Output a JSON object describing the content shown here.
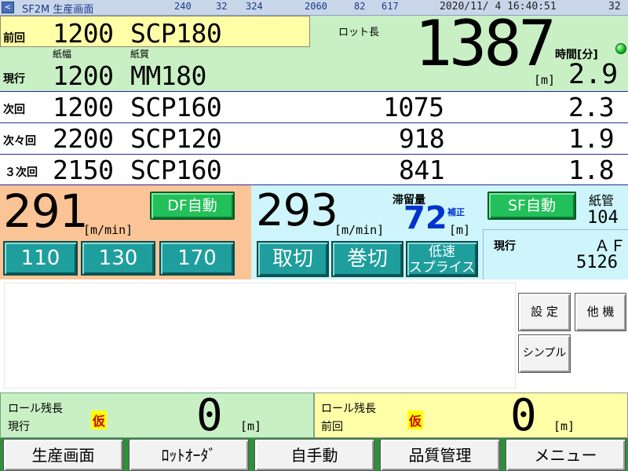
{
  "titlebar": {
    "title": "SF2M 生産画面",
    "nums": [
      "240",
      "32",
      "324",
      "2060",
      "82",
      "617"
    ],
    "datetime": "2020/11/ 4 16:40:51",
    "right_num": "32"
  },
  "current_lot": {
    "prev_label": "前回",
    "prev_width": "1200",
    "prev_grade": "SCP180",
    "width_label": "紙幅",
    "grade_label": "紙質",
    "cur_label": "現行",
    "cur_width": "1200",
    "cur_grade": "MM180",
    "lot_length_label": "ロット長",
    "lot_length": "1387",
    "lot_unit": "[m]",
    "time_label": "時間[分]",
    "time_value": "2.9"
  },
  "next_rows": [
    {
      "label": "次回",
      "width": "1200",
      "grade": "SCP160",
      "length": "1075",
      "time": "2.3"
    },
    {
      "label": "次々回",
      "width": "2200",
      "grade": "SCP120",
      "length": "918",
      "time": "1.9"
    },
    {
      "label": "３次回",
      "width": "2150",
      "grade": "SCP160",
      "length": "841",
      "time": "1.8"
    }
  ],
  "df": {
    "speed": "291",
    "unit": "[m/min]",
    "auto_button": "DF自動",
    "presets": [
      "110",
      "130",
      "170"
    ]
  },
  "sf_speed": {
    "speed": "293",
    "unit": "[m/min]",
    "retention_label": "滞留量",
    "retention_value": "72",
    "correction_label": "補正",
    "retention_unit": "[m]",
    "cut_button": "取切",
    "wind_cut_button": "巻切",
    "splice_button_1": "低速",
    "splice_button_2": "スプライス"
  },
  "sf": {
    "auto_button": "SF自動",
    "core_label": "紙管",
    "core_value": "104",
    "current_label": "現行",
    "current_code": "ＡＦ",
    "current_num": "5126"
  },
  "side_buttons": {
    "settings": "設 定",
    "other": "他 機",
    "simple": "シンプル"
  },
  "roll_left": {
    "label": "ロール残長",
    "sub_label": "現行",
    "badge": "仮",
    "value": "0",
    "unit": "[m]"
  },
  "roll_right": {
    "label": "ロール残長",
    "sub_label": "前回",
    "badge": "仮",
    "value": "0",
    "unit": "[m]"
  },
  "nav": [
    "生産画面",
    "ﾛｯﾄｵｰﾀﾞ",
    "自手動",
    "品質管理",
    "メニュー"
  ],
  "colors": {
    "green_panel": "#c8f0c4",
    "yellow_panel": "#ffffa8",
    "orange_panel": "#fbc497",
    "cyan_panel": "#cdf5fb",
    "auto_button": "#22c05a",
    "action_button": "#1f9e9e",
    "retention_value": "#0033cc"
  }
}
